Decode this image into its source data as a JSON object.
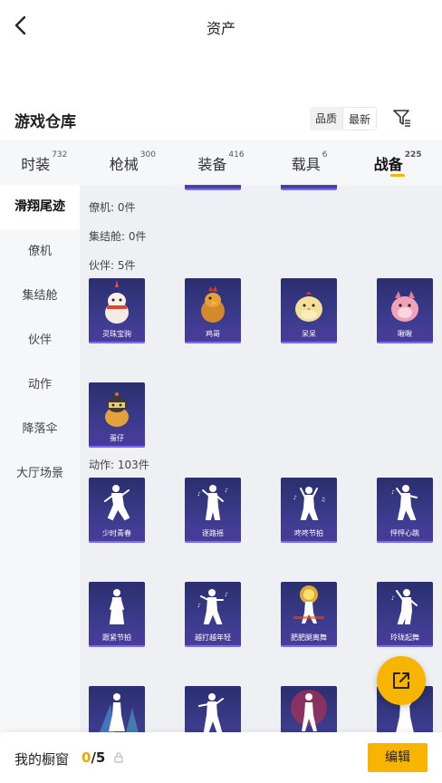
{
  "header": {
    "title": "资产"
  },
  "section": {
    "title": "游戏仓库"
  },
  "sort": {
    "quality": "品质",
    "latest": "最新"
  },
  "tabs": [
    {
      "label": "时装",
      "count": "732"
    },
    {
      "label": "枪械",
      "count": "300"
    },
    {
      "label": "装备",
      "count": "416"
    },
    {
      "label": "载具",
      "count": "6"
    },
    {
      "label": "战备",
      "count": "225"
    }
  ],
  "sidebar": {
    "items": [
      {
        "label": "滑翔尾迹"
      },
      {
        "label": "僚机"
      },
      {
        "label": "集结舱"
      },
      {
        "label": "伙伴"
      },
      {
        "label": "动作"
      },
      {
        "label": "降落伞"
      },
      {
        "label": "大厅场景"
      }
    ]
  },
  "categories": {
    "wingman": "僚机: 0件",
    "pod": "集结舱: 0件",
    "partner": "伙伴: 5件",
    "emote": "动作: 103件"
  },
  "partners": [
    {
      "name": "灵珠宝驹",
      "icon": "unicorn-pet-icon"
    },
    {
      "name": "鸡哥",
      "icon": "chicken-pet-icon"
    },
    {
      "name": "呆呆",
      "icon": "chick-pet-icon"
    },
    {
      "name": "啾啾",
      "icon": "pink-bird-pet-icon"
    },
    {
      "name": "蛋仔",
      "icon": "egg-boy-pet-icon"
    }
  ],
  "emotes": [
    {
      "name": "少时青春"
    },
    {
      "name": "逐路摇"
    },
    {
      "name": "咚咚节拍"
    },
    {
      "name": "怦怦心跳"
    },
    {
      "name": "跟紧节拍"
    },
    {
      "name": "越打越年轻"
    },
    {
      "name": "肥肥腿离舞"
    },
    {
      "name": "玲珑起舞"
    },
    {
      "name": ""
    },
    {
      "name": ""
    },
    {
      "name": ""
    },
    {
      "name": ""
    }
  ],
  "bottom": {
    "showcase_label": "我的橱窗",
    "showcase_current": "0",
    "showcase_total": "/5",
    "edit_label": "编辑"
  },
  "colors": {
    "accent": "#f7b500",
    "card_bg": "#2a2f6e",
    "count_highlight": "#f0a500"
  }
}
